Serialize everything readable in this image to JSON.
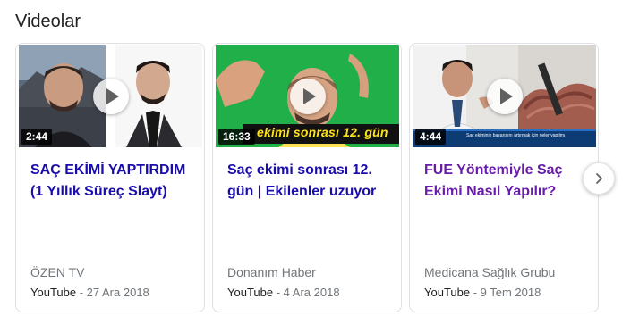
{
  "section": {
    "title": "Videolar"
  },
  "videos": [
    {
      "title": "SAÇ EKİMİ YAPTIRDIM (1 Yıllık Süreç Slayt)",
      "duration": "2:44",
      "channel": "ÖZEN TV",
      "source": "YouTube",
      "date": "27 Ara 2018",
      "visited": false
    },
    {
      "title": "Saç ekimi sonrası 12. gün | Ekilenler uzuyor",
      "duration": "16:33",
      "thumb_caption": "ekimi sonrası 12. gün",
      "channel": "Donanım Haber",
      "source": "YouTube",
      "date": "4 Ara 2018",
      "visited": false
    },
    {
      "title": "FUE Yöntemiyle Saç Ekimi Nasıl Yapılır?",
      "duration": "4:44",
      "thumb_caption": "Saç ekiminin başarısını artırmak için neler yapılmalıdır?",
      "channel": "Medicana Sağlık Grubu",
      "source": "YouTube",
      "date": "9 Tem 2018",
      "visited": true
    }
  ],
  "colors": {
    "link": "#1a0dab",
    "visited_link": "#681da8",
    "muted": "#70757a",
    "border": "#dfe1e5"
  },
  "icons": {
    "play": "play-icon",
    "next": "chevron-right-icon"
  }
}
